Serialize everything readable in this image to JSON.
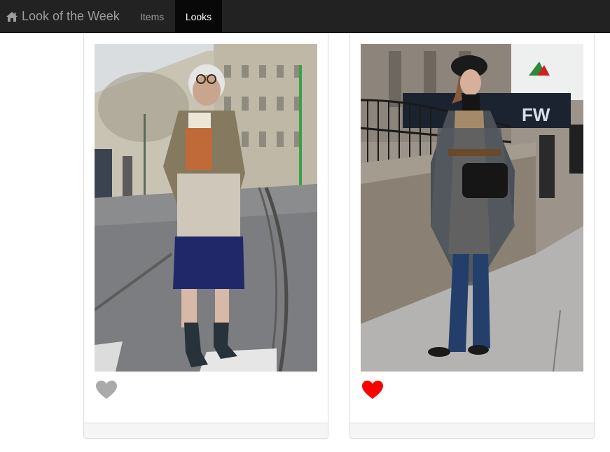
{
  "navbar": {
    "brand_label": "Look of the Week",
    "brand_icon": "home-icon",
    "items": [
      {
        "label": "Items",
        "active": false
      },
      {
        "label": "Looks",
        "active": true
      }
    ]
  },
  "looks": [
    {
      "liked": false,
      "heart_color": "#aaaaaa"
    },
    {
      "liked": true,
      "heart_color": "#ff0000"
    }
  ],
  "colors": {
    "navbar_bg": "#222222",
    "nav_active_bg": "#080808",
    "nav_text": "#9d9d9d",
    "nav_active_text": "#ffffff",
    "card_border": "#dddddd",
    "card_footer_bg": "#f5f5f5"
  }
}
